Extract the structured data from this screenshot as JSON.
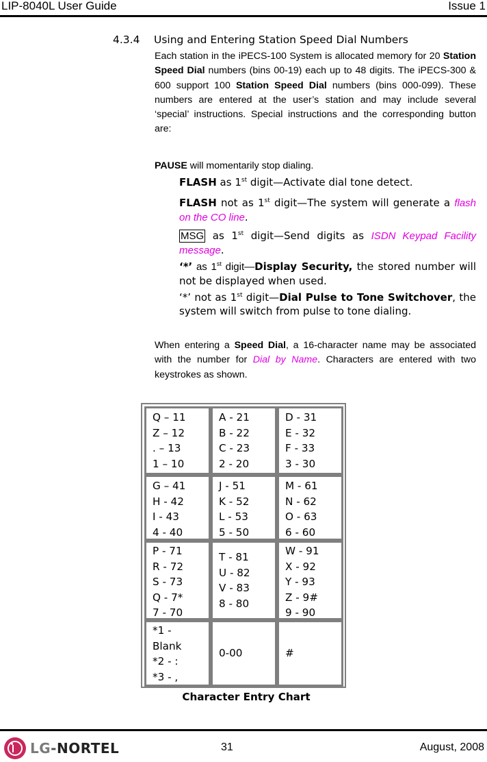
{
  "header": {
    "title": "LIP-8040L User Guide",
    "issue": "Issue 1"
  },
  "section": {
    "number": "4.3.4",
    "title": "Using and Entering Station Speed Dial Numbers"
  },
  "intro": {
    "t1": "Each station in the iPECS-100 System is allocated memory for 20 ",
    "b1": "Station Speed Dial",
    "t2": " numbers (bins 00-19) each up to 48 digits.  The iPECS-300 & 600 support 100 ",
    "b2": "Station Speed Dial",
    "t3": " numbers (bins 000-099). These numbers are entered at the user’s station and may include several ‘special’ instructions.  Special instructions and the corresponding button are:"
  },
  "pause": {
    "bold": "PAUSE",
    "text": " will momentarily stop dialing."
  },
  "items": {
    "flash1": {
      "bold": "FLASH",
      "pre": " as 1",
      "sup": "st",
      "post": " digit—Activate dial tone detect."
    },
    "flash2": {
      "bold": "FLASH",
      "pre": " not as 1",
      "sup": "st",
      "post": " digit—The system will generate a ",
      "link": "flash on the CO line",
      "end": "."
    },
    "msg": {
      "button": "MSG",
      "pre": " as 1",
      "sup": "st",
      "post": " digit—Send digits as ",
      "link": "ISDN Keypad Facility message",
      "end": "."
    },
    "star1": {
      "key": "‘*’",
      "pre": " as 1",
      "sup": "st",
      "post": " digit—",
      "bold": "Display Security,",
      "end": " the stored number will not be displayed when used."
    },
    "star2": {
      "key": "‘*’",
      "pre": " not as 1",
      "sup": "st",
      "post": " digit—",
      "bold": "Dial Pulse to Tone Switchover",
      "end": ", the system will switch from pulse to tone dialing."
    }
  },
  "name_para": {
    "t1": "When entering a ",
    "bold": "Speed Dial",
    "t2": ", a 16-character name may be associated with the number for ",
    "link": "Dial by Name",
    "t3": ". Characters are entered with two keystrokes as shown."
  },
  "colors": {
    "link": "#e000e0",
    "table_border": "#7f7f7f",
    "logo_red": "#c9285c"
  },
  "char_table": {
    "caption": "Character Entry Chart",
    "rows": [
      [
        [
          "Q –  11",
          "Z – 12",
          ". – 13",
          "1 – 10"
        ],
        [
          "A - 21",
          "B - 22",
          "C - 23",
          "2 - 20"
        ],
        [
          "D - 31",
          "E - 32",
          "F - 33",
          "3 - 30"
        ]
      ],
      [
        [
          "G –  41",
          "H - 42",
          "I - 43",
          "4 - 40"
        ],
        [
          "J - 51",
          "K - 52",
          "L - 53",
          "5 - 50"
        ],
        [
          "M - 61",
          "N - 62",
          "O - 63",
          "6 - 60"
        ]
      ],
      [
        [
          "P - 71",
          "R - 72",
          "S - 73",
          "Q - 7*",
          "7 - 70"
        ],
        [
          "T - 81",
          "U - 82",
          "V - 83",
          "8 - 80"
        ],
        [
          "W - 91",
          "X - 92",
          "Y - 93",
          "Z - 9#",
          "9 - 90"
        ]
      ],
      [
        [
          "*1 -",
          "Blank",
          "*2 - :",
          "*3 - ,"
        ],
        [
          "0-00"
        ],
        [
          "#"
        ]
      ]
    ]
  },
  "footer": {
    "logo_lg": "LG",
    "logo_dash": "-",
    "logo_nortel": "NORTEL",
    "page_number": "31",
    "date": "August, 2008"
  }
}
